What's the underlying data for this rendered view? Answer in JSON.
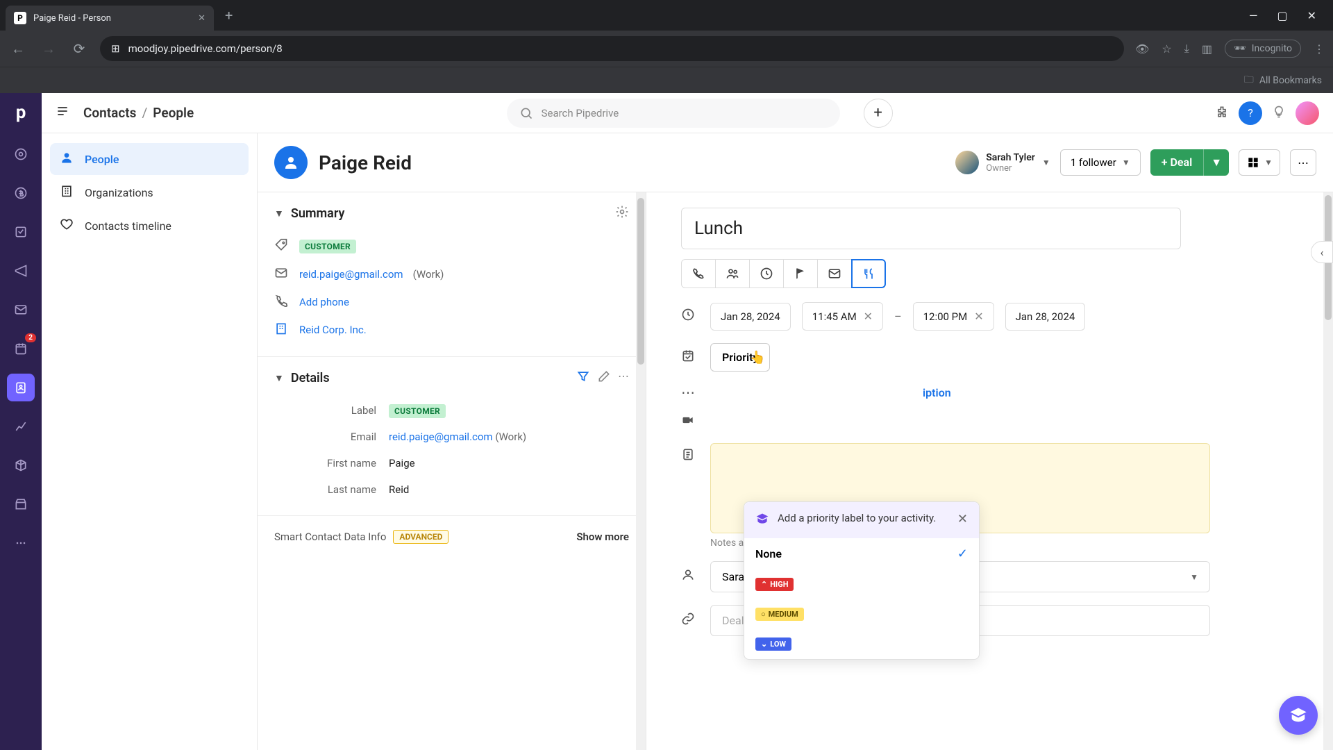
{
  "browser": {
    "tab_title": "Paige Reid - Person",
    "url": "moodjoy.pipedrive.com/person/8",
    "incognito": "Incognito",
    "all_bookmarks": "All Bookmarks"
  },
  "topbar": {
    "breadcrumb_root": "Contacts",
    "breadcrumb_current": "People",
    "search_placeholder": "Search Pipedrive"
  },
  "sidebar": {
    "items": [
      {
        "label": "People"
      },
      {
        "label": "Organizations"
      },
      {
        "label": "Contacts timeline"
      }
    ]
  },
  "rail": {
    "badge": "2"
  },
  "person": {
    "name": "Paige Reid",
    "owner_name": "Sarah Tyler",
    "owner_role": "Owner",
    "follower_btn": "1 follower",
    "deal_btn": "Deal"
  },
  "summary": {
    "title": "Summary",
    "tag": "CUSTOMER",
    "email": "reid.paige@gmail.com",
    "email_suffix": "(Work)",
    "add_phone": "Add phone",
    "org": "Reid Corp. Inc."
  },
  "details": {
    "title": "Details",
    "label_label": "Label",
    "label_value": "CUSTOMER",
    "email_label": "Email",
    "email_value": "reid.paige@gmail.com",
    "email_suffix": "(Work)",
    "first_label": "First name",
    "first_value": "Paige",
    "last_label": "Last name",
    "last_value": "Reid"
  },
  "smart": {
    "text": "Smart Contact Data Info",
    "badge": "ADVANCED",
    "more": "Show more"
  },
  "activity": {
    "title": "Lunch",
    "date_start": "Jan 28, 2024",
    "time_start": "11:45 AM",
    "time_end": "12:00 PM",
    "date_end": "Jan 28, 2024",
    "priority_label": "Priority",
    "description_link": "iption",
    "notes_hint": "Notes are visible within Pipedrive, but not to event guests",
    "owner_value": "Sarah Tyler (You)",
    "deal_placeholder": "Deal, Lead or Project"
  },
  "priority_popover": {
    "hint": "Add a priority label to your activity.",
    "none_label": "None",
    "high": "HIGH",
    "medium": "MEDIUM",
    "low": "LOW"
  }
}
